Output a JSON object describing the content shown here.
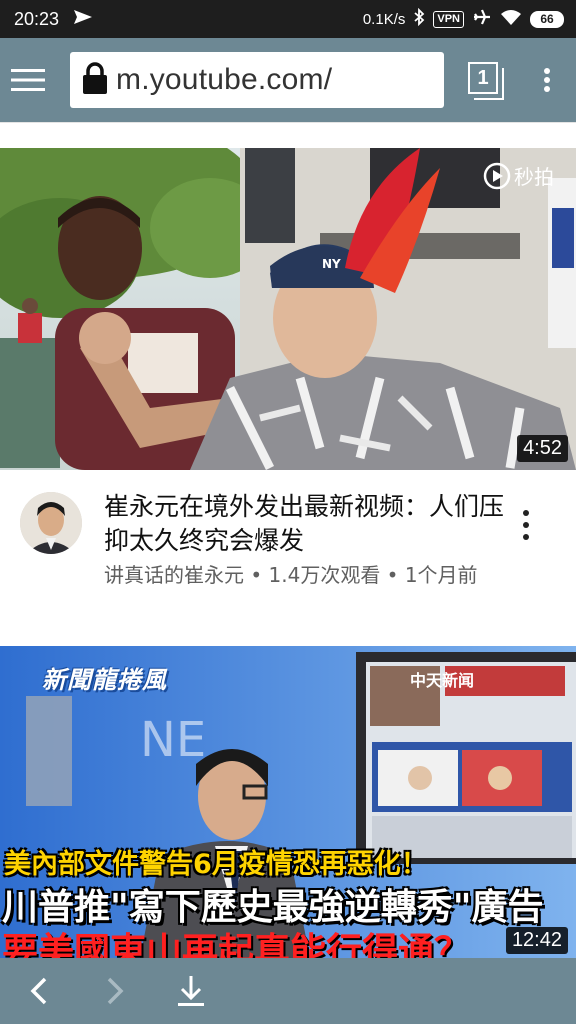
{
  "status_bar": {
    "time": "20:23",
    "net_speed": "0.1K/s",
    "vpn_label": "VPN",
    "battery": "66"
  },
  "browser": {
    "url": "m.youtube.com/",
    "tab_count": "1"
  },
  "videos": [
    {
      "title": "崔永元在境外发出最新视频：人们压抑太久终究会爆发",
      "subtitle": "讲真话的崔永元 • 1.4万次观看 • 1个月前",
      "duration": "4:52",
      "watermark": "秒拍"
    },
    {
      "duration": "12:42",
      "thumb_badge": "新聞龍捲風",
      "thumb_channel": "中天新闻",
      "thumb_caption_1": "美內部文件警告6月疫情恐再惡化！",
      "thumb_caption_2": "川普推\"寫下歷史最強逆轉秀\"廣告",
      "thumb_caption_3": "要美國東山再起真能行得通？"
    }
  ],
  "colors": {
    "toolbar": "#6d8894",
    "status_bar": "#1e1e1e"
  }
}
